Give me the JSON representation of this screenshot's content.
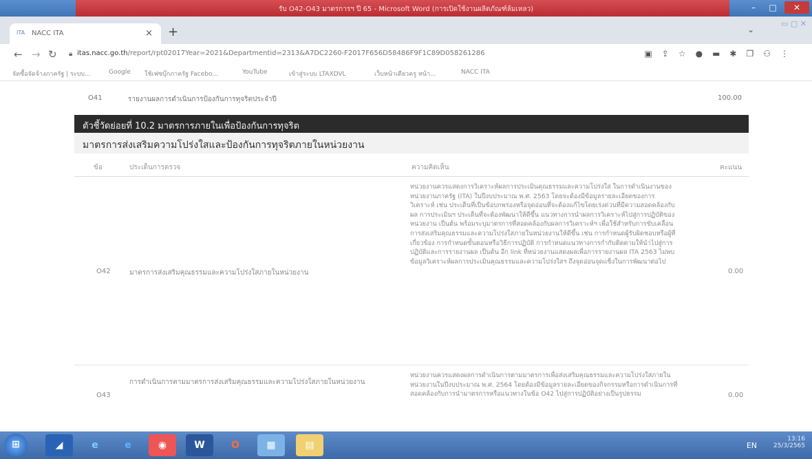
{
  "word_window": {
    "quick_access": "",
    "title": "รับ O42-O43 มาตรการฯ ปี 65 - Microsoft Word (การเปิดใช้งานผลิตภัณฑ์ล้มเหลว)"
  },
  "browser": {
    "tab_title": "NACC ITA",
    "url_host": "itas.nacc.go.th",
    "url_path": "/report/rpt02017Year=2021&Departmentid=2313&A7DC2260-F2017F656D58486F9F1C89D058261286",
    "bookmarks": [
      "จัดซื้อจัดจ้างภาครัฐ | ระบบ...",
      "Google",
      "ใช้เฟซบุ๊กภาครัฐ Facebo...",
      "YouTube",
      "เข้าสู่ระบบ LTAXDVL",
      "เว็บหน้าเดียวครู หน้า...",
      "NACC ITA"
    ]
  },
  "content": {
    "row_o41": {
      "code": "O41",
      "name": "รายงานผลการดำเนินการป้องกันการทุจริตประจำปี",
      "score": "100.00"
    },
    "subindicator_title": "ตัวชี้วัดย่อยที่ 10.2 มาตรการภายในเพื่อป้องกันการทุจริต",
    "section_title": "มาตรการส่งเสริมความโปร่งใสและป้องกันการทุจริตภายในหน่วยงาน",
    "headers": {
      "no": "ข้อ",
      "issue": "ประเด็นการตรวจ",
      "comment": "ความคิดเห็น",
      "score": "คะแนน"
    },
    "rows": [
      {
        "code": "O42",
        "issue": "มาตรการส่งเสริมคุณธรรมและความโปร่งใสภายในหน่วยงาน",
        "comment": "หน่วยงานควรแสดงการวิเคราะห์ผลการประเมินคุณธรรมและความโปร่งใส ในการดำเนินงานของหน่วยงานภาครัฐ (ITA) ในปีงบประมาณ พ.ศ. 2563 โดยจะต้องมีข้อมูลรายละเอียดของการวิเคราะห์ เช่น ประเด็นที่เป็นข้อบกพร่องหรือจุดอ่อนที่จะต้องแก้ไขโดยเร่งด่วนที่มีความสอดคล้องกับผล การประเมินฯ ประเด็นที่จะต้องพัฒนาให้ดีขึ้น แนวทางการนำผลการวิเคราะห์ไปสู่การปฏิบัติของหน่วยงาน เป็นต้น พร้อมระบุมาตรการที่สอดคล้องกับผลการวิเคราะห์ฯ เพื่อใช้สำหรับการขับเคลื่อนการส่งเสริมคุณธรรมและความโปร่งใสภายในหน่วยงานให้ดีขึ้น เช่น การกำหนดผู้รับผิดชอบหรือผู้ที่เกี่ยวข้อง การกำหนดขั้นตอนหรือวิธีการปฏิบัติ การกำหนดแนวทางการกำกับติดตามให้นำไปสู่การปฏิบัติและการรายงานผล เป็นต้น อีก link ที่หน่วยงานแสดงผลเพื่อการรายงานผล ITA 2563 ไม่พบข้อมูลวิเคราะห์ผลการประเมินคุณธรรมและความโปร่งใสฯ ถึงจุดอ่อนจุดแข็งในการพัฒนาต่อไป",
        "score": "0.00"
      },
      {
        "code": "O43",
        "issue": "การดำเนินการตามมาตรการส่งเสริมคุณธรรมและความโปร่งใสภายในหน่วยงาน",
        "comment": "หน่วยงานควรแสดงผลการดำเนินการตามมาตรการเพื่อส่งเสริมคุณธรรมและความโปร่งใสภายในหน่วยงานในปีงบประมาณ พ.ศ. 2564 โดยต้องมีข้อมูลรายละเอียดของกิจกรรมหรือการดำเนินการที่สอดคล้องกับการนำมาตรการหรือแนวทางในข้อ O42 ไปสู่การปฏิบัติอย่างเป็นรูปธรรม",
        "score": "0.00"
      }
    ]
  },
  "taskbar": {
    "apps": [
      "start",
      "app-a",
      "ie",
      "edge",
      "chrome",
      "word",
      "office",
      "app-b",
      "app-c"
    ],
    "lang": "EN",
    "time": "13:16",
    "date": "25/3/2565"
  }
}
